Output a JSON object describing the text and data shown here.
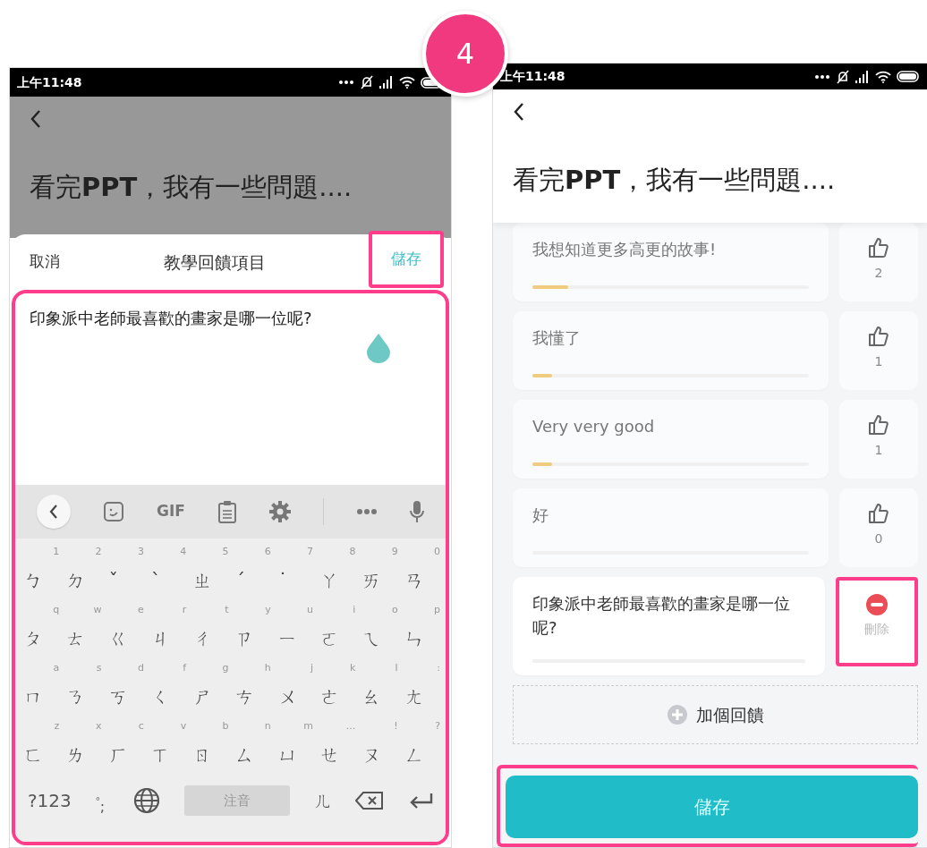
{
  "step_badge": "4",
  "left_screen": {
    "status_bar": {
      "time": "上午11:48"
    },
    "page_title": "看完**PPT**，我有一些問題....",
    "sheet": {
      "cancel": "取消",
      "title": "教學回饋項目",
      "save": {
        "label": "儲存",
        "highlighted": true
      }
    },
    "input_panel": {
      "highlighted": true,
      "value": "印象派中老師最喜歡的畫家是哪一位呢?",
      "keyboard": {
        "toolbar_label": "GIF",
        "rows": [
          [
            {
              "hint": "1",
              "key": "ㄅ"
            },
            {
              "hint": "2",
              "key": "ㄉ"
            },
            {
              "hint": "3",
              "key": "ˇ"
            },
            {
              "hint": "4",
              "key": "ˋ"
            },
            {
              "hint": "5",
              "key": "ㄓ"
            },
            {
              "hint": "6",
              "key": "ˊ"
            },
            {
              "hint": "7",
              "key": "˙"
            },
            {
              "hint": "8",
              "key": "ㄚ"
            },
            {
              "hint": "9",
              "key": "ㄞ"
            },
            {
              "hint": "0",
              "key": "ㄢ"
            }
          ],
          [
            {
              "hint": "q",
              "key": "ㄆ"
            },
            {
              "hint": "w",
              "key": "ㄊ"
            },
            {
              "hint": "e",
              "key": "ㄍ"
            },
            {
              "hint": "r",
              "key": "ㄐ"
            },
            {
              "hint": "t",
              "key": "ㄔ"
            },
            {
              "hint": "y",
              "key": "ㄗ"
            },
            {
              "hint": "u",
              "key": "ㄧ"
            },
            {
              "hint": "i",
              "key": "ㄛ"
            },
            {
              "hint": "o",
              "key": "ㄟ"
            },
            {
              "hint": "p",
              "key": "ㄣ"
            }
          ],
          [
            {
              "hint": "a",
              "key": "ㄇ"
            },
            {
              "hint": "s",
              "key": "ㄋ"
            },
            {
              "hint": "d",
              "key": "ㄎ"
            },
            {
              "hint": "f",
              "key": "ㄑ"
            },
            {
              "hint": "g",
              "key": "ㄕ"
            },
            {
              "hint": "h",
              "key": "ㄘ"
            },
            {
              "hint": "j",
              "key": "ㄨ"
            },
            {
              "hint": "k",
              "key": "ㄜ"
            },
            {
              "hint": "l",
              "key": "ㄠ"
            },
            {
              "hint": ":",
              "key": "ㄤ"
            }
          ],
          [
            {
              "hint": "z",
              "key": "ㄈ"
            },
            {
              "hint": "x",
              "key": "ㄌ"
            },
            {
              "hint": "c",
              "key": "ㄏ"
            },
            {
              "hint": "v",
              "key": "ㄒ"
            },
            {
              "hint": "b",
              "key": "ㄖ"
            },
            {
              "hint": "n",
              "key": "ㄙ"
            },
            {
              "hint": "m",
              "key": "ㄩ"
            },
            {
              "hint": "…",
              "key": "ㄝ"
            },
            {
              "hint": "!",
              "key": "ㄡ"
            },
            {
              "hint": "?",
              "key": "ㄥ"
            }
          ]
        ],
        "bottom_row": {
          "symbols": "?123",
          "punctuation_hint": "。",
          "punctuation": ";",
          "space": "注音",
          "extra_key": "ㄦ"
        }
      }
    }
  },
  "right_screen": {
    "status_bar": {
      "time": "上午11:48"
    },
    "page_title": "看完**PPT**，我有一些問題....",
    "feedback_items": [
      {
        "kind": "vote",
        "text": "我想知道更多高更的故事!",
        "level": 0.13,
        "votes": "2"
      },
      {
        "kind": "vote",
        "text": "我懂了",
        "level": 0.07,
        "votes": "1"
      },
      {
        "kind": "vote",
        "text": "Very very good",
        "level": 0.07,
        "votes": "1"
      },
      {
        "kind": "vote",
        "text": "好",
        "level": 0,
        "votes": "0"
      },
      {
        "kind": "delete",
        "text": "印象派中老師最喜歡的畫家是哪一位呢?",
        "level": 0,
        "delete_label": "刪除",
        "highlighted": true
      }
    ],
    "add_button": "加個回饋",
    "save_button": {
      "label": "儲存",
      "highlighted": true
    }
  }
}
